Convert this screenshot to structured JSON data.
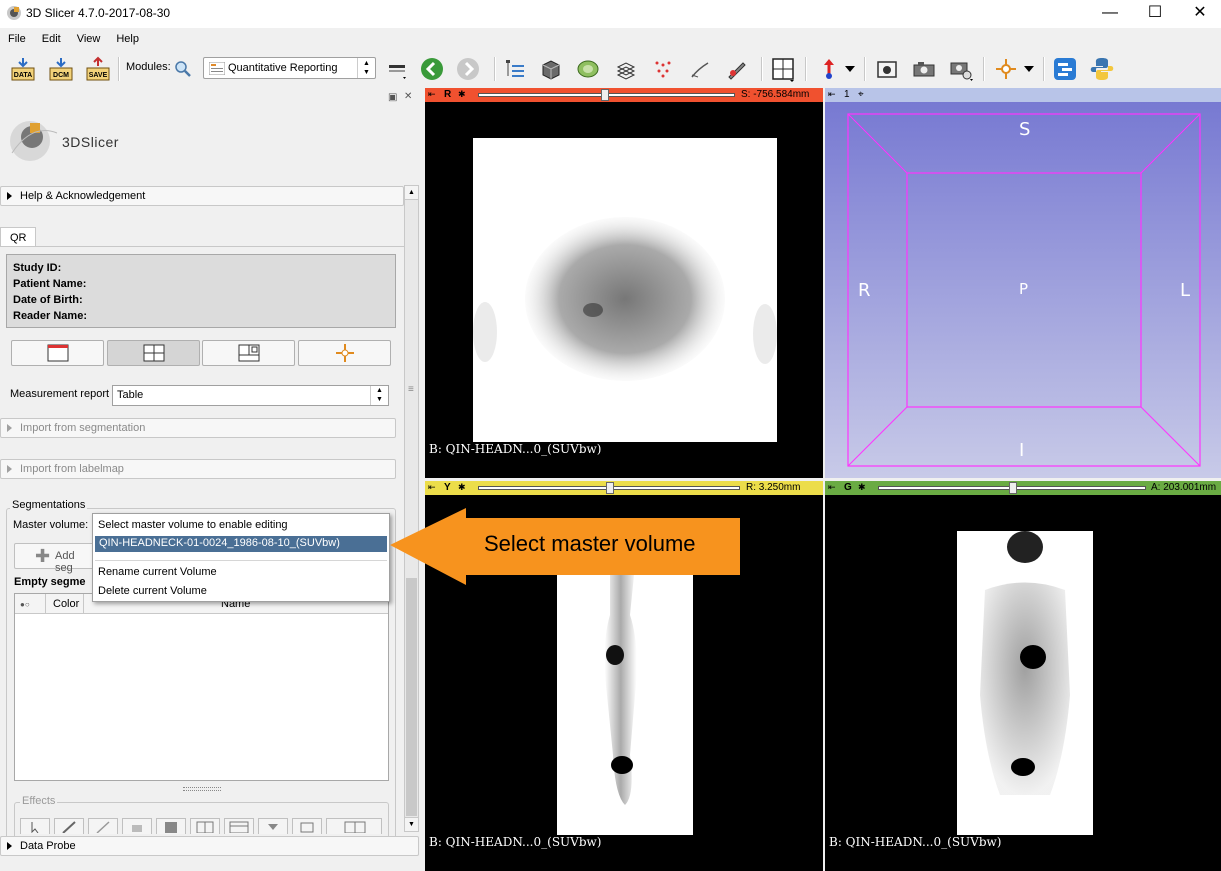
{
  "window": {
    "title": "3D Slicer 4.7.0-2017-08-30",
    "minimize": "—",
    "maximize": "☐",
    "close": "✕"
  },
  "menu": [
    "File",
    "Edit",
    "View",
    "Help"
  ],
  "toolbar": {
    "data_label": "DATA",
    "dcm_label": "DCM",
    "save_label": "SAVE",
    "modules_label": "Modules:",
    "module_value": "Quantitative Reporting"
  },
  "left_panel": {
    "logo_text": "3DSlicer",
    "help_section": "Help & Acknowledgement",
    "tab": "QR",
    "info": {
      "study_id": "Study ID:",
      "patient_name": "Patient Name:",
      "dob": "Date of Birth:",
      "reader_name": "Reader Name:"
    },
    "measurement_report_label": "Measurement report",
    "measurement_report_value": "Table",
    "import_segmentation": "Import from segmentation",
    "import_labelmap": "Import from labelmap",
    "segmentations_title": "Segmentations",
    "master_volume_label": "Master volume:",
    "add_segment": "Add seg",
    "empty_segments": "Empty segme",
    "table_headers": {
      "color": "Color",
      "name": "Name"
    },
    "effects_title": "Effects",
    "data_probe": "Data Probe"
  },
  "dropdown": {
    "items": [
      "Select master volume to enable editing",
      "QIN-HEADNECK-01-0024_1986-08-10_(SUVbw)",
      "Rename current Volume",
      "Delete current Volume"
    ],
    "selected_index": 1
  },
  "views": {
    "red": {
      "letter": "R",
      "offset": "S: -756.584mm",
      "label": "B: QIN-HEADN...0_(SUVbw)",
      "color": "#f0512f"
    },
    "three_d": {
      "number": "1",
      "orient": {
        "s": "S",
        "r": "R",
        "p": "P",
        "l": "L",
        "i": "I"
      }
    },
    "yellow": {
      "letter": "Y",
      "offset": "R: 3.250mm",
      "label": "B: QIN-HEADN...0_(SUVbw)",
      "color": "#ecdd4a"
    },
    "green": {
      "letter": "G",
      "offset": "A: 203.001mm",
      "label": "B: QIN-HEADN...0_(SUVbw)",
      "color": "#6aab43"
    }
  },
  "callout": {
    "text": "Select master volume",
    "color": "#f7931e"
  }
}
